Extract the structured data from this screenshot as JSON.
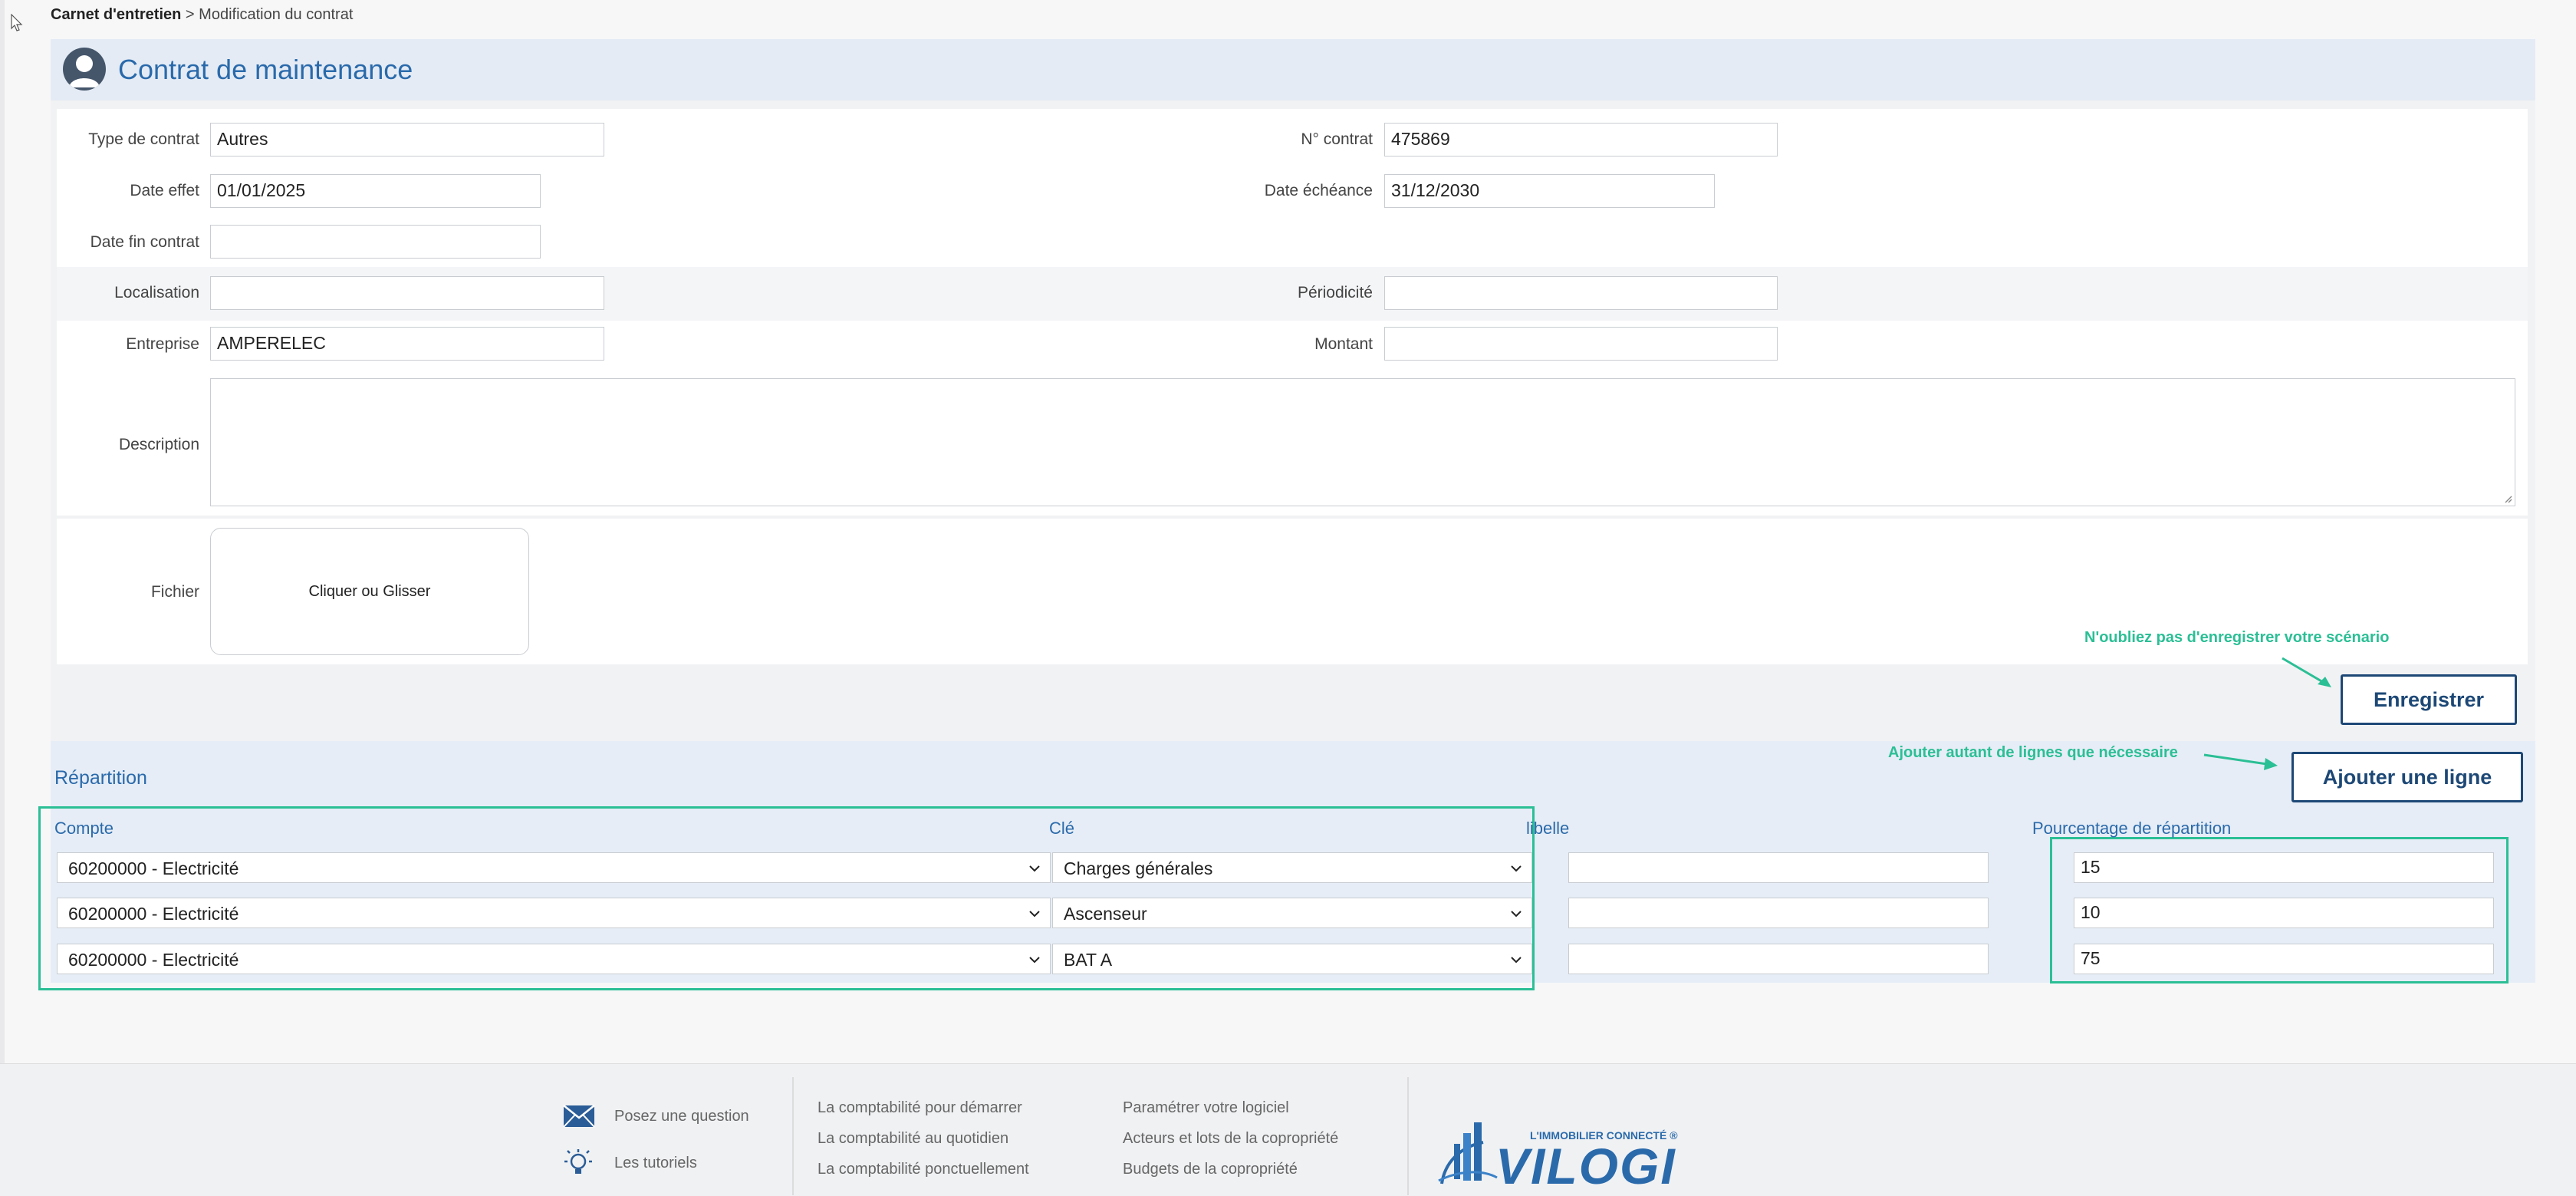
{
  "breadcrumb": {
    "root": "Carnet d'entretien",
    "separator": ">",
    "current": "Modification du contrat"
  },
  "header": {
    "title": "Contrat de maintenance"
  },
  "form": {
    "type_contrat": {
      "label": "Type de contrat",
      "value": "Autres"
    },
    "num_contrat": {
      "label": "N° contrat",
      "value": "475869"
    },
    "date_effet": {
      "label": "Date effet",
      "value": "01/01/2025"
    },
    "date_echeance": {
      "label": "Date échéance",
      "value": "31/12/2030"
    },
    "date_fin": {
      "label": "Date fin contrat",
      "value": ""
    },
    "localisation": {
      "label": "Localisation",
      "value": ""
    },
    "periodicite": {
      "label": "Périodicité",
      "value": ""
    },
    "entreprise": {
      "label": "Entreprise",
      "value": "AMPERELEC"
    },
    "montant": {
      "label": "Montant",
      "value": ""
    },
    "description": {
      "label": "Description",
      "value": ""
    },
    "fichier": {
      "label": "Fichier",
      "dropzone": "Cliquer ou Glisser"
    }
  },
  "notes": {
    "save_hint": "N'oubliez pas d'enregistrer votre scénario",
    "add_hint": "Ajouter autant de lignes que nécessaire"
  },
  "buttons": {
    "save": "Enregistrer",
    "add_line": "Ajouter une ligne"
  },
  "repartition": {
    "title": "Répartition",
    "columns": {
      "compte": "Compte",
      "cle": "Clé",
      "libelle": "libelle",
      "pourcentage": "Pourcentage de répartition"
    },
    "rows": [
      {
        "compte": "60200000 - Electricité",
        "cle": "Charges générales",
        "libelle": "",
        "pourcentage": "15"
      },
      {
        "compte": "60200000 - Electricité",
        "cle": "Ascenseur",
        "libelle": "",
        "pourcentage": "10"
      },
      {
        "compte": "60200000 - Electricité",
        "cle": "BAT A",
        "libelle": "",
        "pourcentage": "75"
      }
    ]
  },
  "footer": {
    "help": [
      {
        "icon": "envelope-icon",
        "label": "Posez une question"
      },
      {
        "icon": "lightbulb-icon",
        "label": "Les tutoriels"
      }
    ],
    "col1": [
      "La comptabilité pour démarrer",
      "La comptabilité au quotidien",
      "La comptabilité ponctuellement"
    ],
    "col2": [
      "Paramétrer votre logiciel",
      "Acteurs et lots de la copropriété",
      "Budgets de la copropriété"
    ],
    "brand": {
      "tagline": "L'IMMOBILIER CONNECTÉ ®",
      "name": "VILOGI"
    }
  },
  "colors": {
    "accent_blue": "#2a6aab",
    "button_navy": "#1d4876",
    "highlight_green": "#2bbf95"
  }
}
